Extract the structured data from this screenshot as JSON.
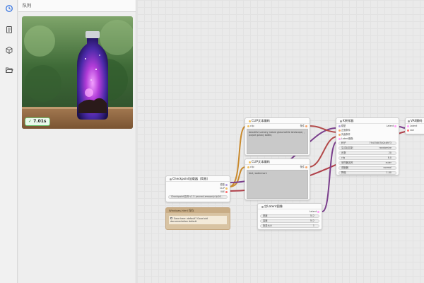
{
  "sidebar": {
    "icons": [
      "history-icon",
      "book-icon",
      "cube-icon",
      "folder-open-icon"
    ]
  },
  "queue": {
    "title": "队列",
    "badge": "7.01s"
  },
  "nodes": {
    "clip_top": {
      "title": "CLIP文本编码",
      "port_in": "clip",
      "port_out": "条件",
      "text": "beautiful scenery nature glass bottle landscape, , purple galaxy bottle,"
    },
    "clip_bottom": {
      "title": "CLIP文本编码",
      "port_in": "clip",
      "port_out": "条件",
      "text": "text, watermark"
    },
    "checkpoint": {
      "title": "Checkpoint加载器（简易）",
      "out_model": "模型",
      "out_clip": "CLIP",
      "out_vae": "VAE",
      "ckpt": "Checkpoint名称   v1-5-pruned-emaonly-fp16..."
    },
    "note": {
      "title": "Windows.html 保存",
      "body": "Save here: default? Good old documentation default"
    },
    "latent": {
      "title": "空Latent图像",
      "out": "Latent",
      "rows": [
        {
          "k": "宽度",
          "v": "512"
        },
        {
          "k": "高度",
          "v": "512"
        },
        {
          "k": "批量大小",
          "v": "1"
        }
      ]
    },
    "ksampler": {
      "title": "K采样器",
      "out": "Latent",
      "inputs": [
        "模型",
        "正面条件",
        "负面条件",
        "Latent图像"
      ],
      "rows": [
        {
          "k": "种子",
          "v": "794358870046973"
        },
        {
          "k": "生成后控制",
          "v": "randomize"
        },
        {
          "k": "步数",
          "v": "20"
        },
        {
          "k": "cfg",
          "v": "8.0"
        },
        {
          "k": "采样器名称",
          "v": "euler"
        },
        {
          "k": "调度器",
          "v": "normal"
        },
        {
          "k": "降噪",
          "v": "1.00"
        }
      ]
    },
    "vae": {
      "title": "VAE解码",
      "in_samples": "Latent",
      "in_vae": "vae"
    }
  },
  "colors": {
    "model": "#b39ddb",
    "clip": "#f0c060",
    "vae": "#ff6e6e",
    "cond": "#f4a46b",
    "latent": "#ff9cf9",
    "wire_purple": "#7a3e8c",
    "wire_orange": "#c98a2e"
  }
}
